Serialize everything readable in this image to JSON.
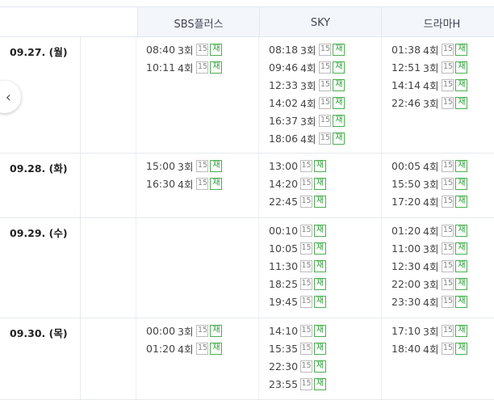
{
  "header": {
    "channels": [
      "SBS플러스",
      "SKY",
      "드라마H"
    ]
  },
  "badges": {
    "rating": "15",
    "rerun": "재"
  },
  "days": [
    {
      "date": "09.27. (월)",
      "channels": [
        [
          [
            "08:40",
            "3회"
          ],
          [
            "10:11",
            "4회"
          ]
        ],
        [
          [
            "08:18",
            "3회"
          ],
          [
            "09:46",
            "4회"
          ],
          [
            "12:33",
            "3회"
          ],
          [
            "14:02",
            "4회"
          ],
          [
            "16:37",
            "3회"
          ],
          [
            "18:06",
            "4회"
          ]
        ],
        [
          [
            "01:38",
            "4회"
          ],
          [
            "12:51",
            "3회"
          ],
          [
            "14:14",
            "4회"
          ],
          [
            "22:46",
            "3회"
          ]
        ]
      ]
    },
    {
      "date": "09.28. (화)",
      "channels": [
        [
          [
            "15:00",
            "3회"
          ],
          [
            "16:30",
            "4회"
          ]
        ],
        [
          [
            "13:00",
            ""
          ],
          [
            "14:20",
            ""
          ],
          [
            "22:45",
            ""
          ]
        ],
        [
          [
            "00:05",
            "4회"
          ],
          [
            "15:50",
            "3회"
          ],
          [
            "17:20",
            "4회"
          ]
        ]
      ]
    },
    {
      "date": "09.29. (수)",
      "channels": [
        [],
        [
          [
            "00:10",
            ""
          ],
          [
            "10:05",
            ""
          ],
          [
            "11:30",
            ""
          ],
          [
            "18:25",
            ""
          ],
          [
            "19:45",
            ""
          ]
        ],
        [
          [
            "01:20",
            "4회"
          ],
          [
            "11:00",
            "3회"
          ],
          [
            "12:30",
            "4회"
          ],
          [
            "22:00",
            "3회"
          ],
          [
            "23:30",
            "4회"
          ]
        ]
      ]
    },
    {
      "date": "09.30. (목)",
      "channels": [
        [
          [
            "00:00",
            "3회"
          ],
          [
            "01:20",
            "4회"
          ]
        ],
        [
          [
            "14:10",
            ""
          ],
          [
            "15:35",
            ""
          ],
          [
            "22:30",
            ""
          ],
          [
            "23:55",
            ""
          ]
        ],
        [
          [
            "17:10",
            "3회"
          ],
          [
            "18:40",
            "4회"
          ]
        ]
      ]
    }
  ]
}
